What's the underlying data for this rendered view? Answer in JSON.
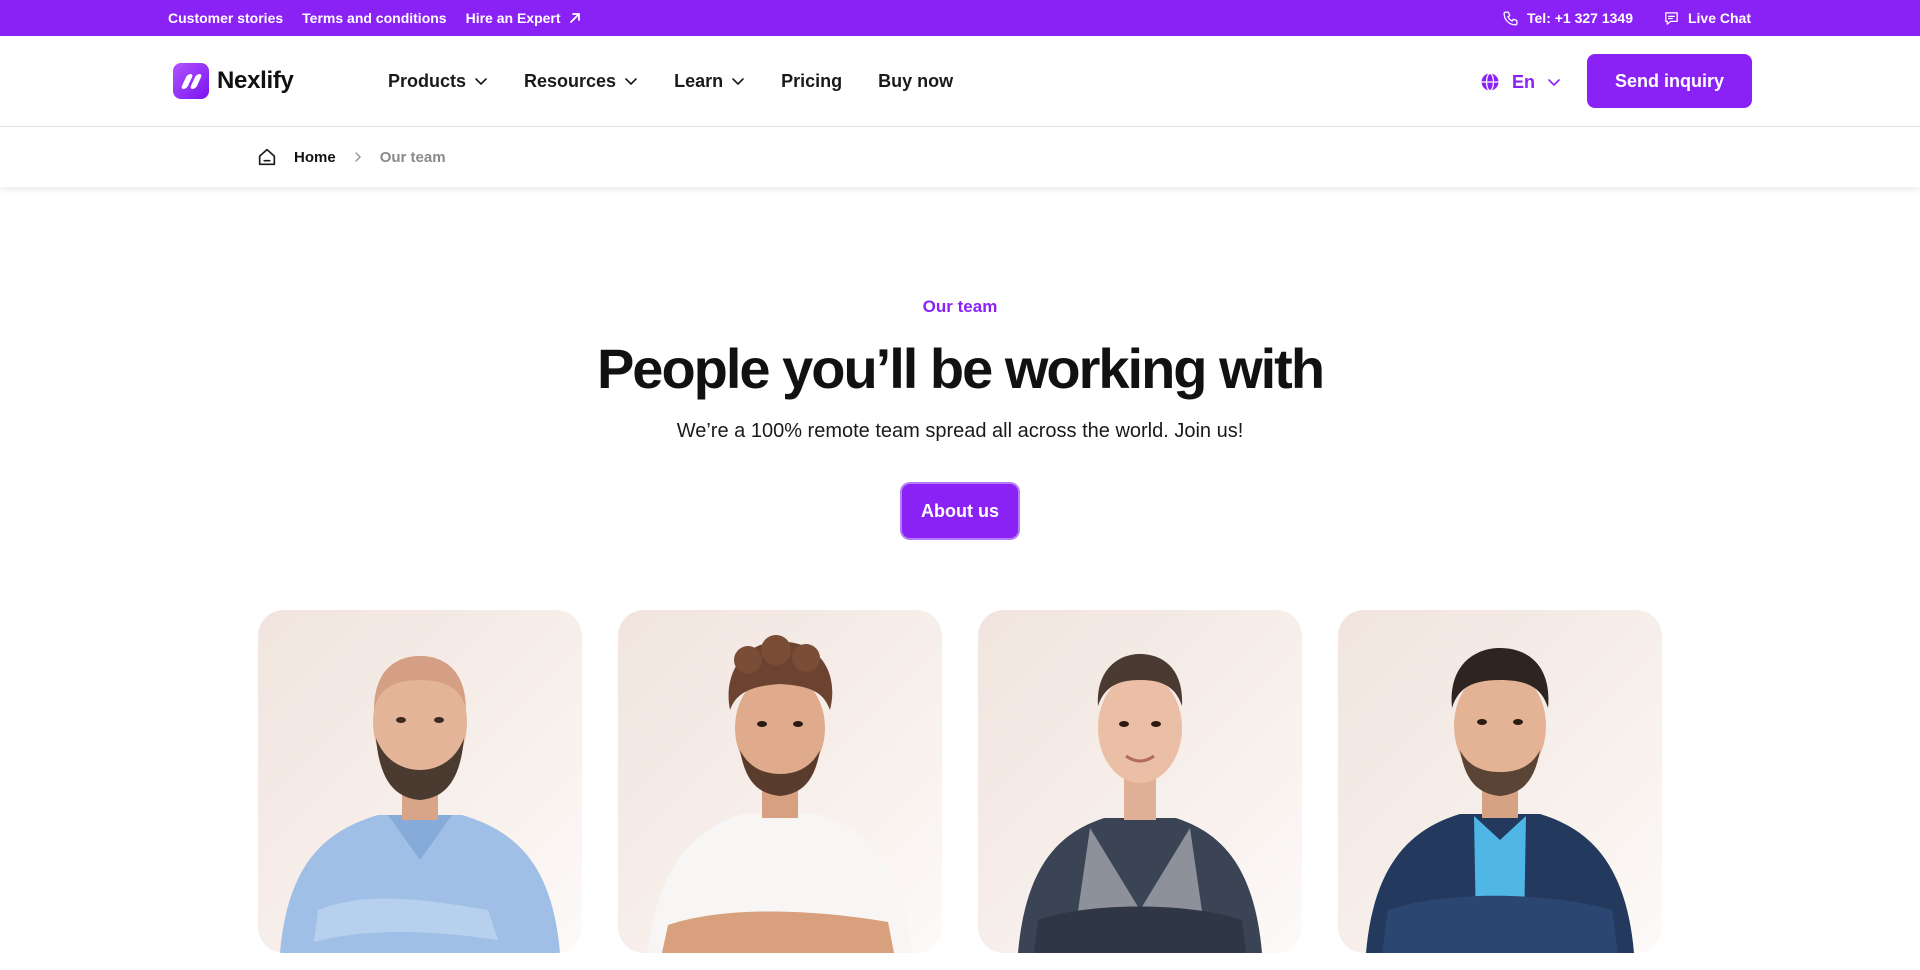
{
  "topbar": {
    "links": [
      {
        "label": "Customer stories"
      },
      {
        "label": "Terms and conditions"
      },
      {
        "label": "Hire an Expert"
      }
    ],
    "phone": "Tel: +1 327 1349",
    "chat": "Live Chat"
  },
  "header": {
    "logo": "Nexlify",
    "nav": [
      "Products",
      "Resources",
      "Learn",
      "Pricing",
      "Buy now"
    ],
    "language": "En",
    "cta": "Send inquiry"
  },
  "breadcrumb": {
    "home": "Home",
    "current": "Our team"
  },
  "hero": {
    "eyebrow": "Our team",
    "title": "People you’ll be working with",
    "subtitle": "We’re a 100% remote team spread all across the world. Join us!",
    "button": "About us"
  },
  "colors": {
    "accent": "#8a22f5",
    "card_bg": "#f3e8e3"
  },
  "icons": {
    "phone": "phone-icon",
    "chat": "chat-icon",
    "external": "arrow-up-right-icon",
    "globe": "globe-icon",
    "home": "home-icon",
    "chevron": "chevron-down-icon"
  }
}
